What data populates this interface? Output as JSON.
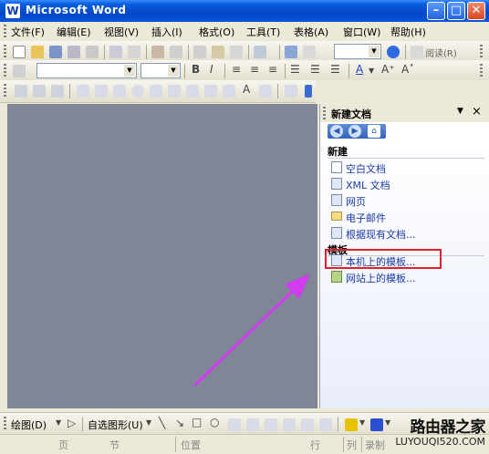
{
  "window": {
    "app_icon_letter": "W",
    "title": "Microsoft Word"
  },
  "menubar": {
    "items": [
      {
        "label": "文件(F)"
      },
      {
        "label": "编辑(E)"
      },
      {
        "label": "视图(V)"
      },
      {
        "label": "插入(I)"
      },
      {
        "label": "格式(O)"
      },
      {
        "label": "工具(T)"
      },
      {
        "label": "表格(A)"
      },
      {
        "label": "窗口(W)"
      },
      {
        "label": "帮助(H)"
      }
    ]
  },
  "toolbar_standard": {
    "read_label": "阅读(R)"
  },
  "toolbar_format": {
    "bold": "B",
    "italic": "I"
  },
  "taskpane": {
    "title": "新建文档",
    "new_section": "新建",
    "new_links": [
      {
        "label": "空白文档",
        "icon": "blank-doc-icon"
      },
      {
        "label": "XML 文档",
        "icon": "xml-doc-icon"
      },
      {
        "label": "网页",
        "icon": "web-page-icon"
      },
      {
        "label": "电子邮件",
        "icon": "email-icon"
      },
      {
        "label": "根据现有文档...",
        "icon": "existing-doc-icon"
      }
    ],
    "template_section": "模板",
    "template_links": [
      {
        "label": "本机上的模板...",
        "icon": "local-template-icon"
      },
      {
        "label": "网站上的模板...",
        "icon": "web-template-icon"
      }
    ]
  },
  "drawbar": {
    "draw_label": "绘图(D)",
    "autoshape_label": "自选图形(U)"
  },
  "statusbar": {
    "page": "页",
    "section": "节",
    "position": "位置",
    "line": "行",
    "column": "列",
    "record": "录制"
  },
  "watermark": {
    "main": "路由器之家",
    "url": "LUYOUQI520.COM"
  },
  "colors": {
    "titlebar": "#0a55d8",
    "doc_background": "#7f8796",
    "highlight": "#e0202a",
    "arrow": "#d23cf0",
    "link": "#1a3aa8"
  }
}
